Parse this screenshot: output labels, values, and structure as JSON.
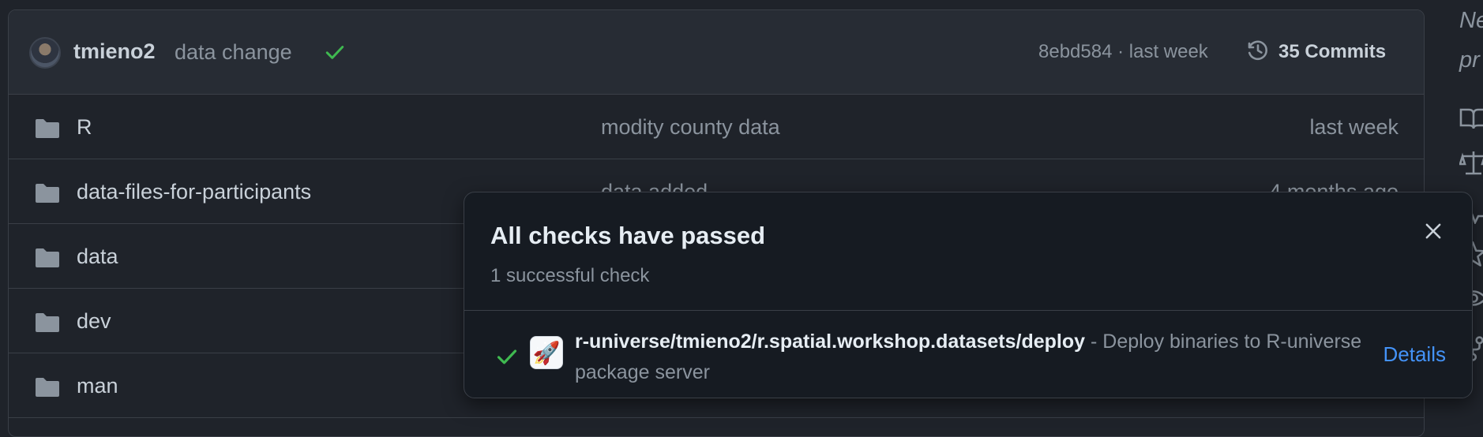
{
  "commit_bar": {
    "author": "tmieno2",
    "message": "data change",
    "sha_time": "8ebd584 · last week",
    "commits_label": "35 Commits"
  },
  "files": [
    {
      "name": "R",
      "message": "modity county data",
      "date": "last week"
    },
    {
      "name": "data-files-for-participants",
      "message": "data added",
      "date": "4 months ago"
    },
    {
      "name": "data",
      "message": "",
      "date": ""
    },
    {
      "name": "dev",
      "message": "",
      "date": ""
    },
    {
      "name": "man",
      "message": "",
      "date": ""
    }
  ],
  "side_panel": {
    "line1": "Ne",
    "line2": "pr"
  },
  "popup": {
    "title": "All checks have passed",
    "subtitle": "1 successful check",
    "check": {
      "name": "r-universe/tmieno2/r.spatial.workshop.datasets/deploy",
      "description": " - Deploy binaries to R-universe package server",
      "details_label": "Details",
      "status": "success"
    }
  },
  "colors": {
    "background": "#1f232a",
    "success": "#3fb950",
    "link": "#4493f8"
  }
}
